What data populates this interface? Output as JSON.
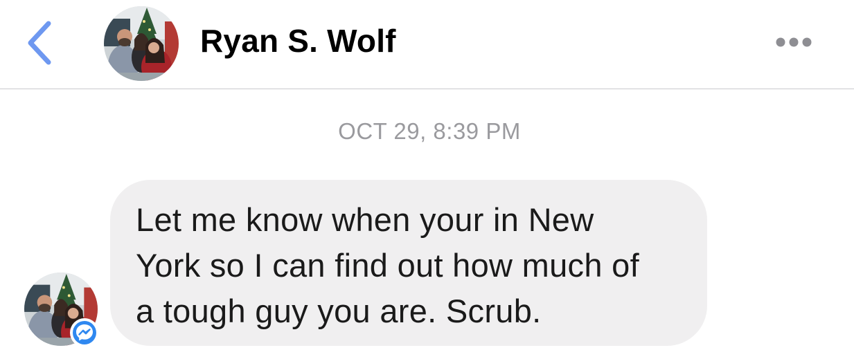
{
  "header": {
    "contact_name": "Ryan S. Wolf",
    "back_icon": "chevron-left-icon",
    "more_icon": "ellipsis-icon",
    "avatar": "contact-photo"
  },
  "thread": {
    "timestamp": "OCT 29, 8:39 PM",
    "messages": [
      {
        "direction": "incoming",
        "lines": [
          "Let me know when your in New",
          "York so I can find out how much of",
          "a tough guy you are. Scrub."
        ],
        "avatar": "contact-photo",
        "badge_icon": "messenger-badge-icon"
      }
    ]
  },
  "colors": {
    "accent": "#6e98f0",
    "bubble_incoming": "#f0eff0",
    "timestamp": "#9a9a9e",
    "messenger_blue": "#2f88f0"
  }
}
